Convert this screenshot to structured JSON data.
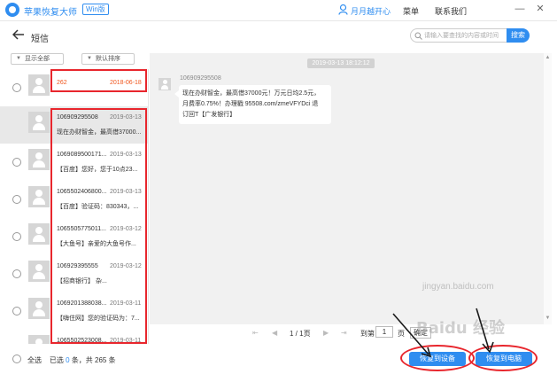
{
  "titlebar": {
    "app_name": "苹果恢复大师",
    "badge": "Win版",
    "user": "月月越开心",
    "menu": "菜单",
    "contact": "联系我们",
    "window_buttons": [
      "—",
      "✕"
    ]
  },
  "header": {
    "title": "短信",
    "search_placeholder": "请输入要查找的内容或时间",
    "search_button": "搜索"
  },
  "filters": {
    "show_all": "显示全部",
    "default_sort": "默认排序"
  },
  "messages": [
    {
      "sender": "262",
      "date": "2018-06-18",
      "preview": ""
    },
    {
      "sender": "106909295508",
      "date": "2019-03-13",
      "preview": "现在办财智金，最高借37000..."
    },
    {
      "sender": "1069089500171...",
      "date": "2019-03-13",
      "preview": "【百度】您好，您于10点23..."
    },
    {
      "sender": "1065502406800...",
      "date": "2019-03-13",
      "preview": "【百度】验证码：830343，..."
    },
    {
      "sender": "1065505775011...",
      "date": "2019-03-12",
      "preview": "【大鱼号】亲爱的大鱼号作..."
    },
    {
      "sender": "106929395555",
      "date": "2019-03-12",
      "preview": "【招商银行】          杂..."
    },
    {
      "sender": "1069201388038...",
      "date": "2019-03-11",
      "preview": "【嗨住网】您的验证码为：7..."
    },
    {
      "sender": "1065502523008...",
      "date": "2019-03-11",
      "preview": ""
    }
  ],
  "conversation": {
    "timestamp": "2019-03-13 18:12:12",
    "sender": "106909295508",
    "body_lines": [
      "现在办财智金，最高借37000元！万元日均2.5元，",
      "月费率0.75%！办理戳 95508.com/zmeVFYDci 退",
      "订回T【广发银行】"
    ]
  },
  "pager": {
    "first": "⇤",
    "prev": "◀",
    "page_info": "1 / 1页",
    "next": "▶",
    "last": "⇥",
    "goto_label": "到第",
    "goto_value": "1",
    "page_label": "页",
    "confirm": "确定"
  },
  "footer": {
    "select_all": "全选",
    "selected_prefix": "已选",
    "selected_count": "0",
    "selected_suffix": "条，共 265 条",
    "recover_to_device": "恢复到设备",
    "recover_to_pc": "恢复到电脑"
  },
  "watermark": {
    "main": "Baidu 经验",
    "sub": "jingyan.baidu.com"
  },
  "colors": {
    "accent": "#2f8df0",
    "annotation_red": "#e8262d",
    "highlight_orange": "#f0561d"
  }
}
